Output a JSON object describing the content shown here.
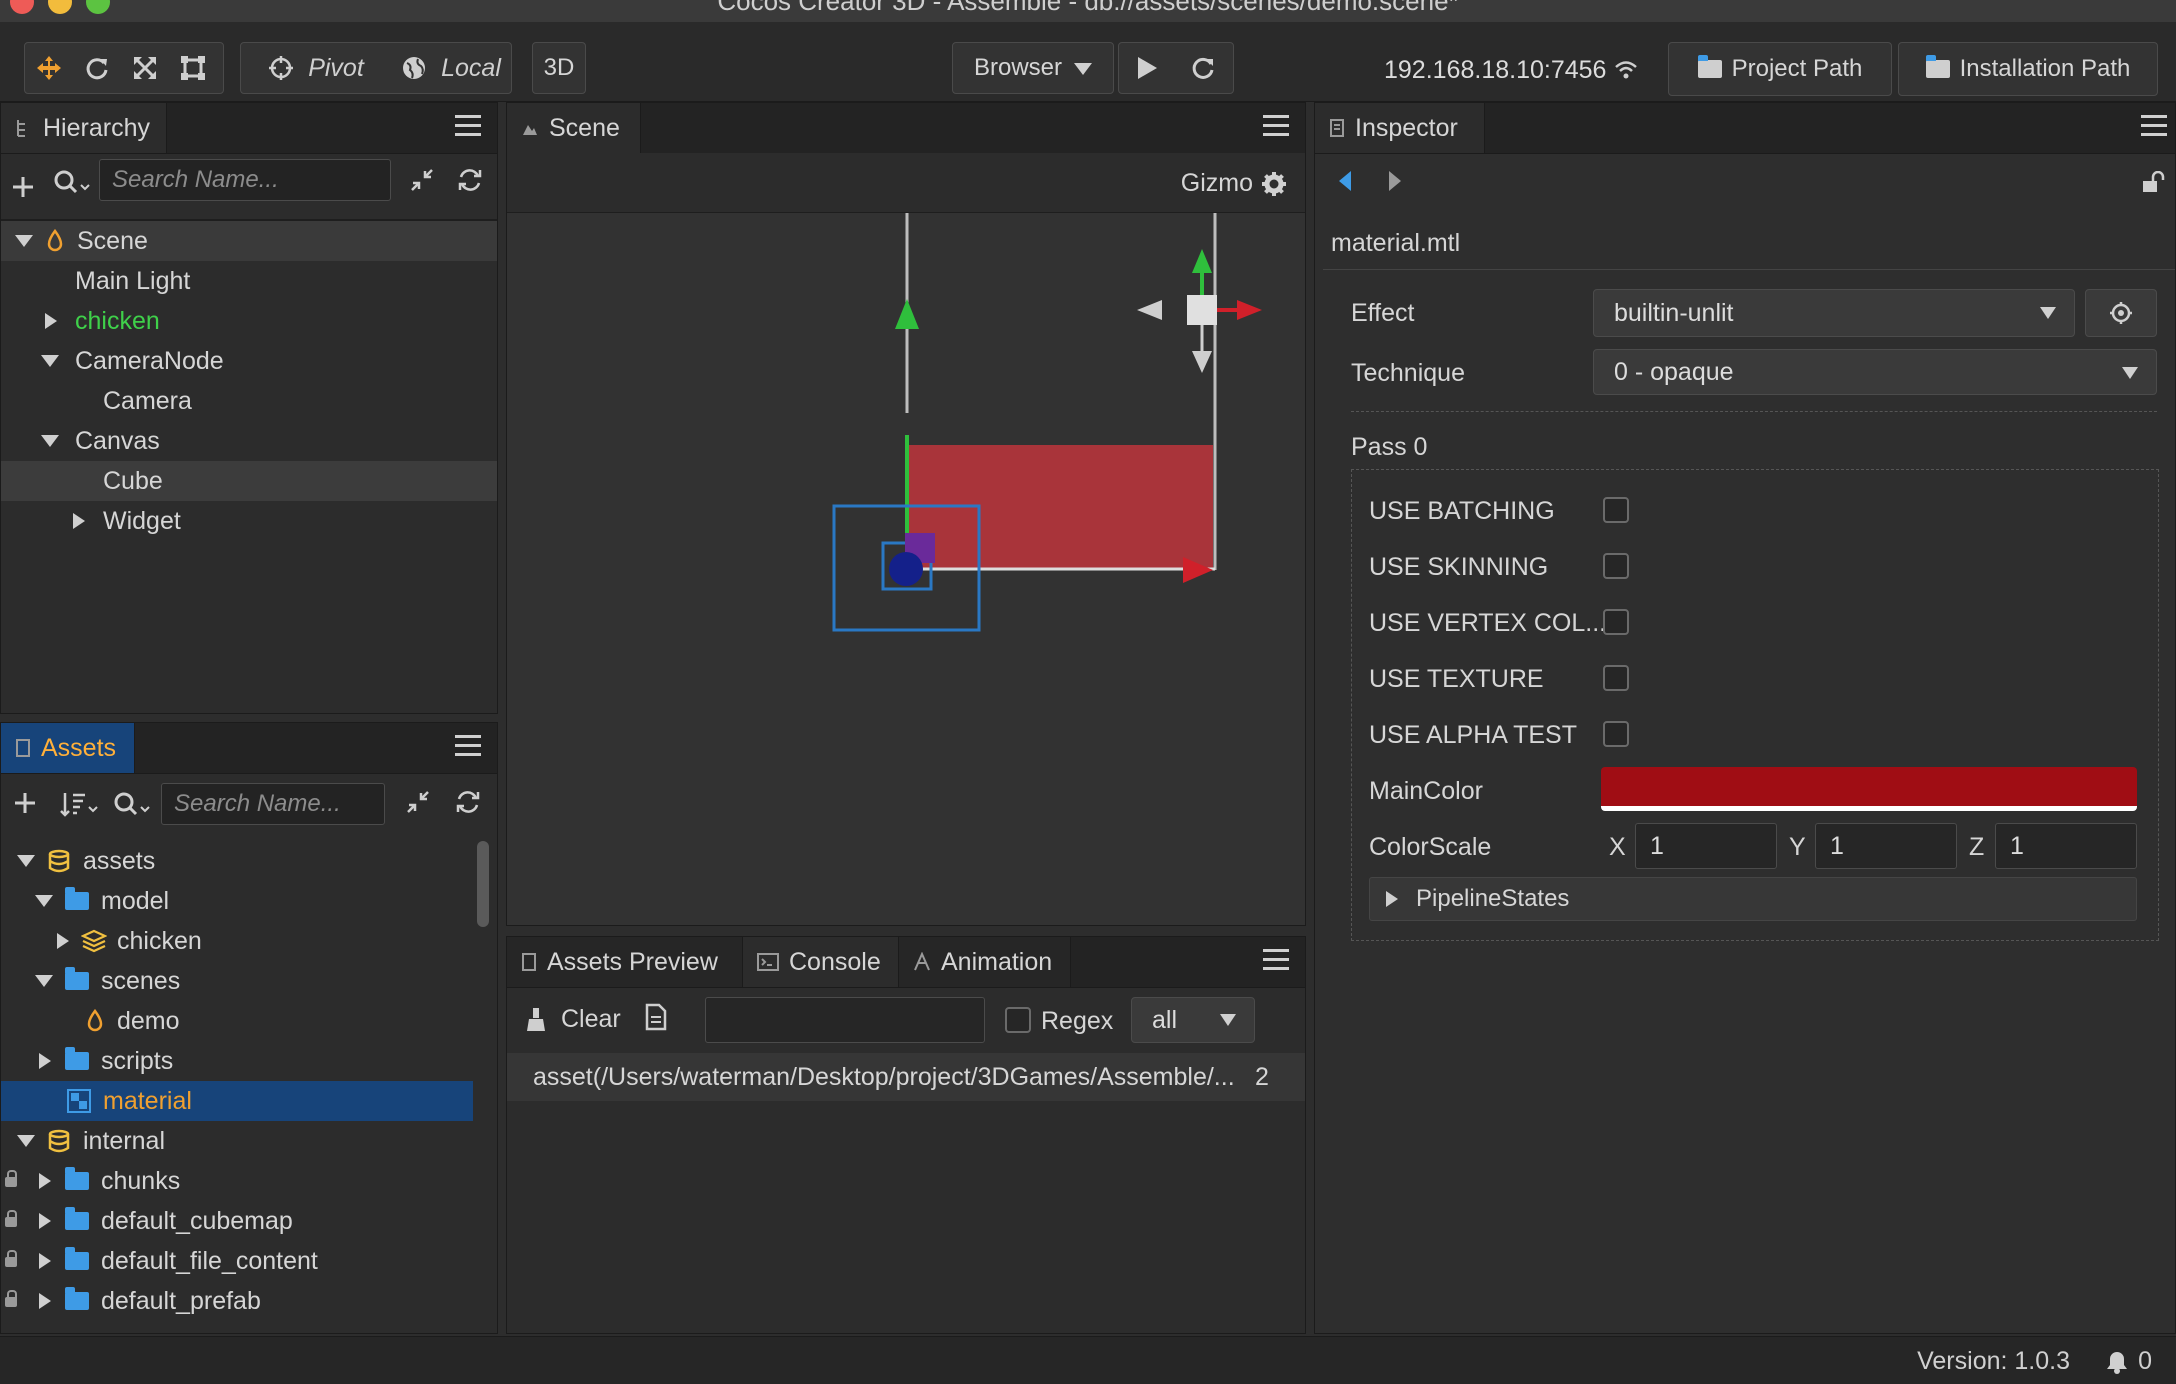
{
  "window": {
    "title": "Cocos Creator 3D - Assemble - db://assets/scenes/demo.scene*"
  },
  "toolbar": {
    "pivot_label": "Pivot",
    "local_label": "Local",
    "mode_3d_label": "3D",
    "browser_label": "Browser",
    "ip_address": "192.168.18.10:7456",
    "project_path_label": "Project Path",
    "installation_path_label": "Installation Path"
  },
  "hierarchy": {
    "tab_label": "Hierarchy",
    "search_placeholder": "Search Name...",
    "nodes": [
      {
        "label": "Scene"
      },
      {
        "label": "Main Light"
      },
      {
        "label": "chicken"
      },
      {
        "label": "CameraNode"
      },
      {
        "label": "Camera"
      },
      {
        "label": "Canvas"
      },
      {
        "label": "Cube"
      },
      {
        "label": "Widget"
      }
    ]
  },
  "assets": {
    "tab_label": "Assets",
    "search_placeholder": "Search Name...",
    "items": [
      {
        "label": "assets"
      },
      {
        "label": "model"
      },
      {
        "label": "chicken"
      },
      {
        "label": "scenes"
      },
      {
        "label": "demo"
      },
      {
        "label": "scripts"
      },
      {
        "label": "material"
      },
      {
        "label": "internal"
      },
      {
        "label": "chunks"
      },
      {
        "label": "default_cubemap"
      },
      {
        "label": "default_file_content"
      },
      {
        "label": "default_prefab"
      }
    ]
  },
  "scene": {
    "tab_label": "Scene",
    "gizmo_label": "Gizmo"
  },
  "console": {
    "tabs": [
      {
        "label": "Assets Preview"
      },
      {
        "label": "Console"
      },
      {
        "label": "Animation"
      }
    ],
    "clear_label": "Clear",
    "regex_label": "Regex",
    "level_value": "all",
    "log_text": "asset(/Users/waterman/Desktop/project/3DGames/Assemble/...",
    "log_count": "2"
  },
  "inspector": {
    "tab_label": "Inspector",
    "asset_name": "material.mtl",
    "effect_label": "Effect",
    "effect_value": "builtin-unlit",
    "technique_label": "Technique",
    "technique_value": "0 - opaque",
    "pass_label": "Pass 0",
    "defines": [
      {
        "label": "USE BATCHING"
      },
      {
        "label": "USE SKINNING"
      },
      {
        "label": "USE VERTEX COL..."
      },
      {
        "label": "USE TEXTURE"
      },
      {
        "label": "USE ALPHA TEST"
      }
    ],
    "main_color_label": "MainColor",
    "main_color_value": "#a00d14",
    "color_scale_label": "ColorScale",
    "color_scale": {
      "x_label": "X",
      "x_value": "1",
      "y_label": "Y",
      "y_value": "1",
      "z_label": "Z",
      "z_value": "1"
    },
    "pipeline_states_label": "PipelineStates"
  },
  "statusbar": {
    "version_text": "Version: 1.0.3",
    "notification_count": "0"
  },
  "colors": {
    "accent_orange": "#f0a030",
    "selection_blue": "#17447a",
    "node_green": "#3fd04a",
    "folder_blue": "#3e9be6"
  }
}
